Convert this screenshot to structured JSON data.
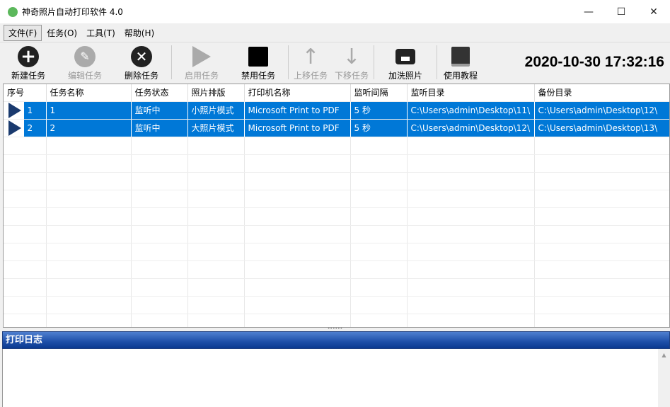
{
  "window": {
    "title": "神奇照片自动打印软件 4.0",
    "controls": [
      "—",
      "☐",
      "✕"
    ]
  },
  "menu": [
    "文件(F)",
    "任务(O)",
    "工具(T)",
    "帮助(H)"
  ],
  "toolbar": {
    "new": "新建任务",
    "edit": "编辑任务",
    "delete": "删除任务",
    "enable": "启用任务",
    "disable": "禁用任务",
    "up": "上移任务",
    "down": "下移任务",
    "print": "加洗照片",
    "tutorial": "使用教程"
  },
  "clock": "2020-10-30 17:32:16",
  "table": {
    "headers": [
      "序号",
      "任务名称",
      "任务状态",
      "照片排版",
      "打印机名称",
      "监听间隔",
      "监听目录",
      "备份目录"
    ],
    "rows": [
      [
        "1",
        "1",
        "监听中",
        "小照片模式",
        "Microsoft Print to PDF",
        "5 秒",
        "C:\\Users\\admin\\Desktop\\11\\",
        "C:\\Users\\admin\\Desktop\\12\\"
      ],
      [
        "2",
        "2",
        "监听中",
        "大照片模式",
        "Microsoft Print to PDF",
        "5 秒",
        "C:\\Users\\admin\\Desktop\\12\\",
        "C:\\Users\\admin\\Desktop\\13\\"
      ]
    ]
  },
  "log": {
    "title": "打印日志"
  }
}
